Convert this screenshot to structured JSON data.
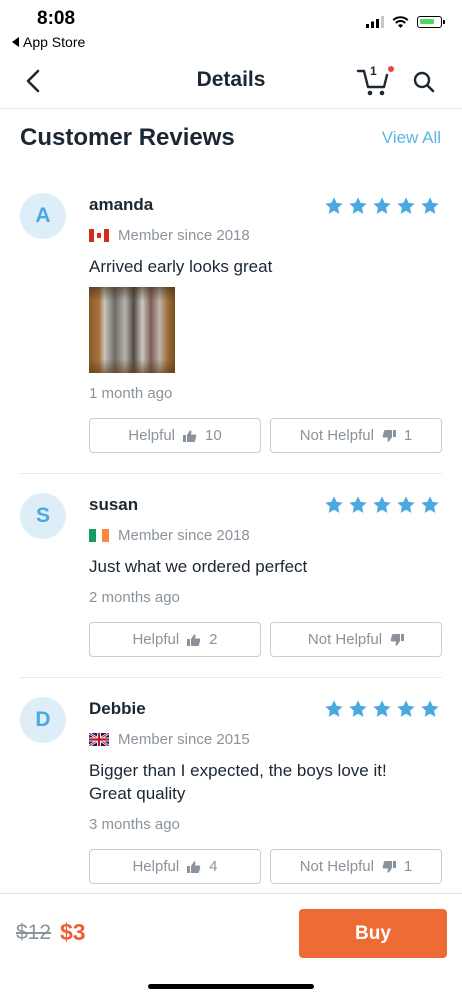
{
  "status_bar": {
    "time": "8:08",
    "back_app": "App Store"
  },
  "nav": {
    "title": "Details",
    "cart_count": "1"
  },
  "section": {
    "title": "Customer Reviews",
    "view_all": "View All"
  },
  "reviews": [
    {
      "avatar": "A",
      "name": "amanda",
      "flag": "canada",
      "member": "Member since 2018",
      "rating": 5,
      "text": "Arrived early looks great",
      "has_photo": true,
      "ago": "1 month ago",
      "helpful": "Helpful",
      "helpful_count": "10",
      "not_helpful": "Not Helpful",
      "not_helpful_count": "1"
    },
    {
      "avatar": "S",
      "name": "susan",
      "flag": "ireland",
      "member": "Member since 2018",
      "rating": 5,
      "text": "Just what we ordered perfect",
      "ago": "2 months ago",
      "helpful": "Helpful",
      "helpful_count": "2",
      "not_helpful": "Not Helpful",
      "not_helpful_count": ""
    },
    {
      "avatar": "D",
      "name": "Debbie",
      "flag": "united-kingdom",
      "member": "Member since 2015",
      "rating": 5,
      "text_line1": "Bigger than I expected, the boys love it!",
      "text_line2": "Great quality",
      "ago": "3 months ago",
      "helpful": "Helpful",
      "helpful_count": "4",
      "not_helpful": "Not Helpful",
      "not_helpful_count": "1"
    }
  ],
  "bottom_bar": {
    "old_price": "$12",
    "new_price": "$3",
    "buy": "Buy"
  },
  "colors": {
    "accent_blue": "#5ab6e5",
    "star": "#4aa9df",
    "buy": "#ee6b35",
    "price": "#ee5d33"
  },
  "icons": [
    "back-arrow-icon",
    "cart-icon",
    "search-icon",
    "star-icon",
    "thumbs-up-icon",
    "thumbs-down-icon"
  ]
}
